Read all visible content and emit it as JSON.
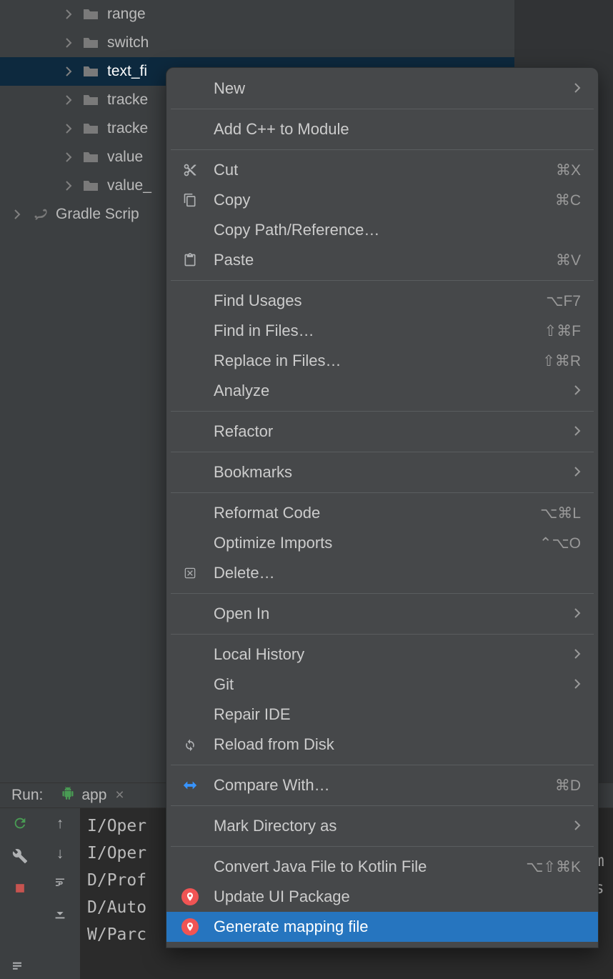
{
  "tree": {
    "items": [
      {
        "label": "range",
        "depth": 3,
        "chevron": true
      },
      {
        "label": "switch",
        "depth": 3,
        "chevron": true
      },
      {
        "label": "text_fi",
        "depth": 3,
        "chevron": true,
        "selected": true
      },
      {
        "label": "tracke",
        "depth": 3,
        "chevron": true
      },
      {
        "label": "tracke",
        "depth": 3,
        "chevron": true
      },
      {
        "label": "value",
        "depth": 3,
        "chevron": true
      },
      {
        "label": "value_",
        "depth": 3,
        "chevron": true
      },
      {
        "label": "Gradle Scrip",
        "depth": 1,
        "chevron": true,
        "gradle": true
      }
    ]
  },
  "run": {
    "label": "Run:",
    "tab": "app"
  },
  "console": {
    "lines": [
      "I/Oper",
      "I/Oper",
      "D/Prof",
      "D/Auto",
      "W/Parc"
    ],
    "right_lines": [
      "om",
      ".s"
    ]
  },
  "menu": {
    "items": [
      {
        "label": "New",
        "submenu": true
      },
      {
        "sep": true
      },
      {
        "label": "Add C++ to Module"
      },
      {
        "sep": true
      },
      {
        "label": "Cut",
        "icon": "cut",
        "shortcut": "⌘X"
      },
      {
        "label": "Copy",
        "icon": "copy",
        "shortcut": "⌘C"
      },
      {
        "label": "Copy Path/Reference…"
      },
      {
        "label": "Paste",
        "icon": "paste",
        "shortcut": "⌘V"
      },
      {
        "sep": true
      },
      {
        "label": "Find Usages",
        "shortcut": "⌥F7"
      },
      {
        "label": "Find in Files…",
        "shortcut": "⇧⌘F"
      },
      {
        "label": "Replace in Files…",
        "shortcut": "⇧⌘R"
      },
      {
        "label": "Analyze",
        "submenu": true
      },
      {
        "sep": true
      },
      {
        "label": "Refactor",
        "submenu": true
      },
      {
        "sep": true
      },
      {
        "label": "Bookmarks",
        "submenu": true
      },
      {
        "sep": true
      },
      {
        "label": "Reformat Code",
        "shortcut": "⌥⌘L"
      },
      {
        "label": "Optimize Imports",
        "shortcut": "⌃⌥O"
      },
      {
        "label": "Delete…",
        "icon": "delete"
      },
      {
        "sep": true
      },
      {
        "label": "Open In",
        "submenu": true
      },
      {
        "sep": true
      },
      {
        "label": "Local History",
        "submenu": true
      },
      {
        "label": "Git",
        "submenu": true
      },
      {
        "label": "Repair IDE"
      },
      {
        "label": "Reload from Disk",
        "icon": "reload"
      },
      {
        "sep": true
      },
      {
        "label": "Compare With…",
        "icon": "diff",
        "shortcut": "⌘D"
      },
      {
        "sep": true
      },
      {
        "label": "Mark Directory as",
        "submenu": true
      },
      {
        "sep": true
      },
      {
        "label": "Convert Java File to Kotlin File",
        "shortcut": "⌥⇧⌘K"
      },
      {
        "label": "Update UI Package",
        "icon": "reddot"
      },
      {
        "label": "Generate mapping file",
        "icon": "reddot",
        "highlighted": true
      }
    ]
  }
}
